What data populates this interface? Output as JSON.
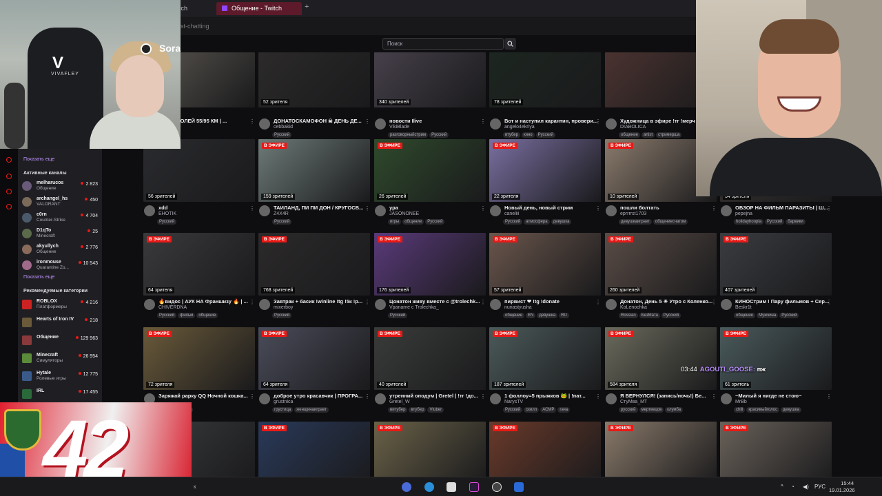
{
  "browser": {
    "tab_partial": "tch",
    "tab_active": "Общение - Twitch",
    "new_tab": "+",
    "address_partial": "st-chatting"
  },
  "search": {
    "placeholder": "Поиск"
  },
  "sidebar": {
    "show_more_1": "Показать еще",
    "active_header": "Активные каналы",
    "channels": [
      {
        "name": "melharucos",
        "game": "Общение",
        "viewers": "2 823"
      },
      {
        "name": "archangel_hs",
        "game": "VALORANT",
        "viewers": "450"
      },
      {
        "name": "c0rn",
        "game": "Counter-Strike",
        "viewers": "4 704"
      },
      {
        "name": "D1qTo",
        "game": "Minecraft",
        "viewers": "25"
      },
      {
        "name": "akyullych",
        "game": "Общение",
        "viewers": "2 776"
      },
      {
        "name": "ironmouse",
        "game": "Quarantine Zo...",
        "viewers": "10 543"
      }
    ],
    "show_more_2": "Показать еще",
    "rec_header": "Рекомендуемые категории",
    "categories": [
      {
        "name": "ROBLOX",
        "game": "Платформеры",
        "viewers": "4 216"
      },
      {
        "name": "Hearts of Iron IV",
        "game": "",
        "viewers": "218"
      },
      {
        "name": "Общение",
        "game": "",
        "viewers": "129 963"
      },
      {
        "name": "Minecraft",
        "game": "Симуляторы",
        "viewers": "26 954"
      },
      {
        "name": "Hytale",
        "game": "Ролевые игры",
        "viewers": "12 775"
      },
      {
        "name": "IRL",
        "game": "",
        "viewers": "17 455"
      }
    ]
  },
  "live_label": "В ЭФИРЕ",
  "cards": [
    {
      "title": "ИОН С ПОЛЕЙ 55/95 КМ | ...",
      "channel": "",
      "viewers": "",
      "tags": [],
      "thumb": "#5a5650"
    },
    {
      "title": "ДОНАТОСКАМОФОН ☠ ДЕНЬ ДЕ...",
      "channel": "cebbakid",
      "viewers": "52 зрителя",
      "tags": [
        "Русский"
      ],
      "thumb": "#2c2a2a"
    },
    {
      "title": "новости Ilive",
      "channel": "VikiBlade",
      "viewers": "340 зрителей",
      "tags": [
        "разговорныйстрим",
        "Русский"
      ],
      "thumb": "#46404a"
    },
    {
      "title": "Вот и наступил карантин, провери...",
      "channel": "angelo4ekriya",
      "viewers": "78 зрителей",
      "tags": [
        "втубер",
        "кино",
        "Русский"
      ],
      "thumb": "#1d2620"
    },
    {
      "title": "Художница в эфире !тг !мерч",
      "channel": "DIABOLICA",
      "viewers": "",
      "tags": [
        "общение",
        "artist",
        "стримерша"
      ],
      "thumb": "#4a3330"
    },
    {
      "title": "xdd",
      "channel": "EHOTIK",
      "viewers": "56 зрителей",
      "tags": [
        "Русский"
      ],
      "thumb": "#2a2b2e"
    },
    {
      "title": "ТАИЛАНД, ПИ ПИ ДОН / КРУГОСВ...",
      "channel": "Z4X4R",
      "viewers": "159 зрителей",
      "tags": [
        "Русский"
      ],
      "thumb": "#6d7a78"
    },
    {
      "title": "ура",
      "channel": "JASONONEE",
      "viewers": "26 зрителей",
      "tags": [
        "игры",
        "общение",
        "Русский"
      ],
      "thumb": "#2f4a2c"
    },
    {
      "title": "Новый день, новый стрим",
      "channel": "caneliii",
      "viewers": "22 зрителя",
      "tags": [
        "Русский",
        "атмосфера",
        "девушка"
      ],
      "thumb": "#7a6fa0"
    },
    {
      "title": "пошли болтать",
      "channel": "eprrrrst1703",
      "viewers": "10 зрителей",
      "tags": [
        "девушкаиграет",
        "общениесчатом"
      ],
      "thumb": "#8a7a6c"
    },
    {
      "title": "ОБЗОР НА ФИЛЬМ ПАРАЗИТЫ | Ш...",
      "channel": "pepejna",
      "viewers": "34 зрителя",
      "tags": [
        "holidayhoopla",
        "Русский",
        "барвики"
      ],
      "thumb": "#3a3632"
    },
    {
      "title": "🔥видос | АУК НА Франшизу 🔥 | ...",
      "channel": "CHIVERDNA",
      "viewers": "64 зрителя",
      "tags": [
        "Русский",
        "фильм",
        "общение"
      ],
      "thumb": "#3a3a3c"
    },
    {
      "title": "Завтрак + басик !winline !tg !5к !р...",
      "channel": "mixerboy",
      "viewers": "768 зрителей",
      "tags": [
        "Русский"
      ],
      "thumb": "#2c2a2b"
    },
    {
      "title": "Цонатон живу вместе с @trolechk...",
      "channel": "Vpaname с Trolechka_",
      "viewers": "176 зрителей",
      "tags": [
        "Русский"
      ],
      "thumb": "#5a3a7a"
    },
    {
      "title": "пирвист ❤ !tg !donate",
      "channel": "nunastyusha",
      "viewers": "57 зрителей",
      "tags": [
        "общение",
        "EN",
        "девушка",
        "RU"
      ],
      "thumb": "#6a564c"
    },
    {
      "title": "Донатон, День 5 ☀ Утро с Коленко...",
      "channel": "KoLenochka",
      "viewers": "260 зрителей",
      "tags": [
        "Rossian",
        "БезМата",
        "Русский"
      ],
      "thumb": "#5a4c46"
    },
    {
      "title": "КИНОСтрим ! Пару фильмов + Сер...",
      "channel": "Beskr1t",
      "viewers": "407 зрителей",
      "tags": [
        "общение",
        "Мужчина",
        "Русский"
      ],
      "thumb": "#3a3c40"
    },
    {
      "title": "Заряжай рарку QQ Ночной кошка...",
      "channel": "",
      "viewers": "72 зрителя",
      "tags": [
        "мер",
        "Женщина"
      ],
      "thumb": "#6a5a3a"
    },
    {
      "title": "доброе утро красавчик | ПРОГРА...",
      "channel": "grustnica",
      "viewers": "64 зрителя",
      "tags": [
        "грустица",
        "женщинаиграет"
      ],
      "thumb": "#4a4c5a"
    },
    {
      "title": "утренний оподум | Gretel | !тг !до...",
      "channel": "Gretel_W",
      "viewers": "40 зрителей",
      "tags": [
        "витубер",
        "втубер",
        "Vtuber"
      ],
      "thumb": "#3a3c3a"
    },
    {
      "title": "1 фоллоу=5 прыжков 🐸 | !пат...",
      "channel": "NarysTV",
      "viewers": "187 зрителей",
      "tags": [
        "Русский",
        "скилл",
        "АСМР",
        "гача"
      ],
      "thumb": "#4c5a5a"
    },
    {
      "title": "Я ВЕРНУЛСЯ! (запись/ночь!) Бе...",
      "channel": "СтуМва_МТ",
      "viewers": "584 зрителя",
      "tags": [
        "русский",
        "мертвецов",
        "клумба"
      ],
      "thumb": "#6a6a5c"
    },
    {
      "title": "~Милый я нигде не стою~",
      "channel": "MrBb",
      "viewers": "61 зритель",
      "tags": [
        "chill",
        "красивыйголос",
        "девушка"
      ],
      "thumb": "#4a5a5c"
    },
    {
      "title": "",
      "channel": "",
      "viewers": "",
      "tags": [],
      "thumb": "#3a3c3c"
    },
    {
      "title": "",
      "channel": "",
      "viewers": "",
      "tags": [],
      "thumb": "#2a3a5a"
    },
    {
      "title": "",
      "channel": "",
      "viewers": "",
      "tags": [],
      "thumb": "#6a6248"
    },
    {
      "title": "",
      "channel": "",
      "viewers": "",
      "tags": [],
      "thumb": "#6a3a2a"
    },
    {
      "title": "",
      "channel": "",
      "viewers": "",
      "tags": [],
      "thumb": "#8a7a6a"
    },
    {
      "title": "",
      "channel": "",
      "viewers": "",
      "tags": [],
      "thumb": "#6a625a"
    }
  ],
  "overlay": {
    "brand": "VIVAFLEY",
    "brand_mark": "V",
    "sora": "Sora",
    "badge_number": "42",
    "chat_time": "03:44",
    "chat_user": "AGOUTI_GOOSE:",
    "chat_msg": "пж"
  },
  "taskbar": {
    "lang": "РУС",
    "time": "15:44",
    "date": "19.01.2026",
    "left_text": "к"
  }
}
